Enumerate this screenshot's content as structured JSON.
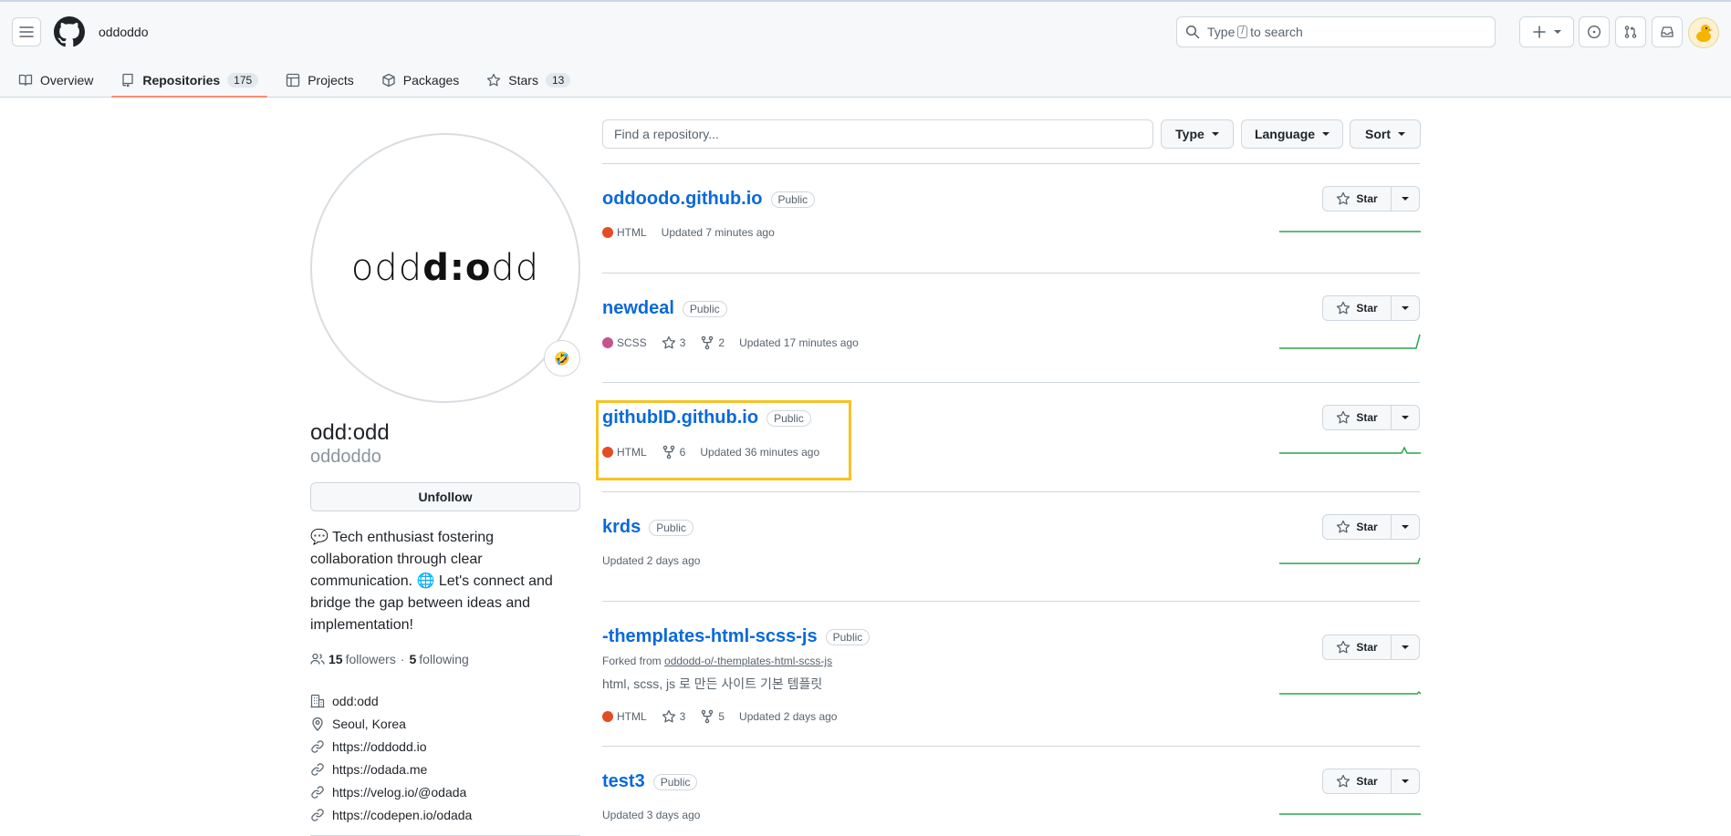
{
  "header": {
    "owner": "oddoddo",
    "search_prefix": "Type",
    "search_key": "/",
    "search_suffix": "to search"
  },
  "tabs": [
    {
      "label": "Overview"
    },
    {
      "label": "Repositories",
      "count": "175"
    },
    {
      "label": "Projects"
    },
    {
      "label": "Packages"
    },
    {
      "label": "Stars",
      "count": "13"
    }
  ],
  "profile": {
    "avatar_text_1": "odd",
    "avatar_text_2": "d:o",
    "avatar_text_3": "dd",
    "status_emoji": "🤣",
    "name": "odd:odd",
    "login": "oddoddo",
    "unfollow_label": "Unfollow",
    "bio": "💬 Tech enthusiast fostering collaboration through clear communication. 🌐 Let's connect and bridge the gap between ideas and implementation!",
    "followers_count": "15",
    "followers_label": "followers",
    "dot": "·",
    "following_count": "5",
    "following_label": "following",
    "company": "odd:odd",
    "location": "Seoul, Korea",
    "links": [
      "https://oddodd.io",
      "https://odada.me",
      "https://velog.io/@odada",
      "https://codepen.io/odada"
    ]
  },
  "filters": {
    "search_placeholder": "Find a repository...",
    "type_label": "Type",
    "language_label": "Language",
    "sort_label": "Sort"
  },
  "star_label": "Star",
  "repos": [
    {
      "name": "oddoodo.github.io",
      "visibility": "Public",
      "language": "HTML",
      "language_color": "#e34c26",
      "updated": "Updated 7 minutes ago"
    },
    {
      "name": "newdeal",
      "visibility": "Public",
      "language": "SCSS",
      "language_color": "#c6538c",
      "stars": "3",
      "forks": "2",
      "updated": "Updated 17 minutes ago"
    },
    {
      "name": "githubID.github.io",
      "visibility": "Public",
      "language": "HTML",
      "language_color": "#e34c26",
      "forks": "6",
      "updated": "Updated 36 minutes ago"
    },
    {
      "name": "krds",
      "visibility": "Public",
      "updated": "Updated 2 days ago"
    },
    {
      "name": "-themplates-html-scss-js",
      "visibility": "Public",
      "forked_prefix": "Forked from",
      "forked_from": "oddodd-o/-themplates-html-scss-js",
      "description": "html, scss, js 로 만든 사이트 기본 템플릿",
      "language": "HTML",
      "language_color": "#e34c26",
      "stars": "3",
      "forks": "5",
      "updated": "Updated 2 days ago"
    },
    {
      "name": "test3",
      "visibility": "Public",
      "updated": "Updated 3 days ago"
    }
  ],
  "colors": {
    "accent_link": "#0969da",
    "tab_underline": "#fd8c73",
    "highlight_box": "#f7c325",
    "sparkline": "#2da44e"
  }
}
